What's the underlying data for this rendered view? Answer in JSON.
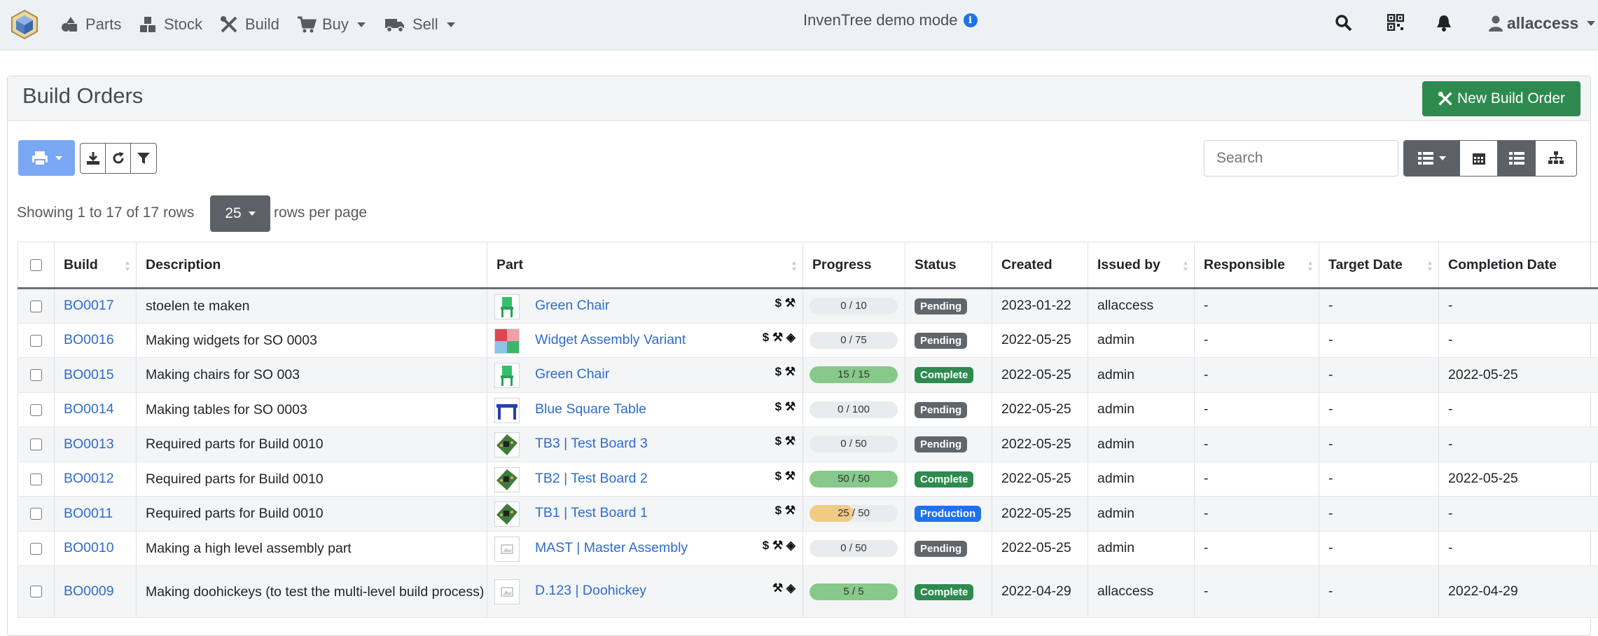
{
  "nav": {
    "items": [
      {
        "label": "Parts",
        "icon": "shapes-icon"
      },
      {
        "label": "Stock",
        "icon": "boxes-icon"
      },
      {
        "label": "Build",
        "icon": "tools-icon"
      },
      {
        "label": "Buy",
        "icon": "shopping-cart-icon"
      },
      {
        "label": "Sell",
        "icon": "truck-icon"
      }
    ],
    "demo_text": "InvenTree demo mode",
    "user": "allaccess"
  },
  "panel": {
    "title": "Build Orders",
    "new_button": "New Build Order"
  },
  "toolbar": {
    "search_placeholder": "Search",
    "showing": "Showing 1 to 17 of 17 rows",
    "page_size": "25",
    "rows_per_page": "rows per page"
  },
  "table": {
    "columns": [
      "Build",
      "Description",
      "Part",
      "Progress",
      "Status",
      "Created",
      "Issued by",
      "Responsible",
      "Target Date",
      "Completion Date"
    ],
    "rows": [
      {
        "build": "BO0017",
        "desc": "stoelen te maken",
        "part": "Green Chair",
        "icons": "$ ⚒",
        "progress": "0 / 10",
        "frac": 0,
        "status": "Pending",
        "created": "2023-01-22",
        "issued": "allaccess",
        "responsible": "-",
        "target": "-",
        "completion": "-",
        "thumb": "chair"
      },
      {
        "build": "BO0016",
        "desc": "Making widgets for SO 0003",
        "part": "Widget Assembly Variant",
        "icons": "$ ⚒ ◈",
        "progress": "0 / 75",
        "frac": 0,
        "status": "Pending",
        "created": "2022-05-25",
        "issued": "admin",
        "responsible": "-",
        "target": "-",
        "completion": "-",
        "thumb": "widget"
      },
      {
        "build": "BO0015",
        "desc": "Making chairs for SO 003",
        "part": "Green Chair",
        "icons": "$ ⚒",
        "progress": "15 / 15",
        "frac": 1,
        "status": "Complete",
        "created": "2022-05-25",
        "issued": "admin",
        "responsible": "-",
        "target": "-",
        "completion": "2022-05-25",
        "thumb": "chair"
      },
      {
        "build": "BO0014",
        "desc": "Making tables for SO 0003",
        "part": "Blue Square Table",
        "icons": "$ ⚒",
        "progress": "0 / 100",
        "frac": 0,
        "status": "Pending",
        "created": "2022-05-25",
        "issued": "admin",
        "responsible": "-",
        "target": "-",
        "completion": "-",
        "thumb": "table"
      },
      {
        "build": "BO0013",
        "desc": "Required parts for Build 0010",
        "part": "TB3 | Test Board 3",
        "icons": "$ ⚒",
        "progress": "0 / 50",
        "frac": 0,
        "status": "Pending",
        "created": "2022-05-25",
        "issued": "admin",
        "responsible": "-",
        "target": "-",
        "completion": "-",
        "thumb": "board"
      },
      {
        "build": "BO0012",
        "desc": "Required parts for Build 0010",
        "part": "TB2 | Test Board 2",
        "icons": "$ ⚒",
        "progress": "50 / 50",
        "frac": 1,
        "status": "Complete",
        "created": "2022-05-25",
        "issued": "admin",
        "responsible": "-",
        "target": "-",
        "completion": "2022-05-25",
        "thumb": "board"
      },
      {
        "build": "BO0011",
        "desc": "Required parts for Build 0010",
        "part": "TB1 | Test Board 1",
        "icons": "$ ⚒",
        "progress": "25 / 50",
        "frac": 0.5,
        "status": "Production",
        "created": "2022-05-25",
        "issued": "admin",
        "responsible": "-",
        "target": "-",
        "completion": "-",
        "thumb": "board"
      },
      {
        "build": "BO0010",
        "desc": "Making a high level assembly part",
        "part": "MAST | Master Assembly",
        "icons": "$ ⚒ ◈",
        "progress": "0 / 50",
        "frac": 0,
        "status": "Pending",
        "created": "2022-05-25",
        "issued": "admin",
        "responsible": "-",
        "target": "-",
        "completion": "-",
        "thumb": "blank"
      },
      {
        "build": "BO0009",
        "desc": "Making doohickeys (to test the multi-level build process)",
        "part": "D.123 | Doohickey",
        "icons": "⚒ ◈",
        "progress": "5 / 5",
        "frac": 1,
        "status": "Complete",
        "created": "2022-04-29",
        "issued": "allaccess",
        "responsible": "-",
        "target": "-",
        "completion": "2022-04-29",
        "thumb": "blank"
      }
    ]
  },
  "colors": {
    "complete_fill": "#86c98a",
    "partial_fill": "#f0cb84",
    "link": "#2d6ccd",
    "new_button": "#2e8a4f"
  }
}
